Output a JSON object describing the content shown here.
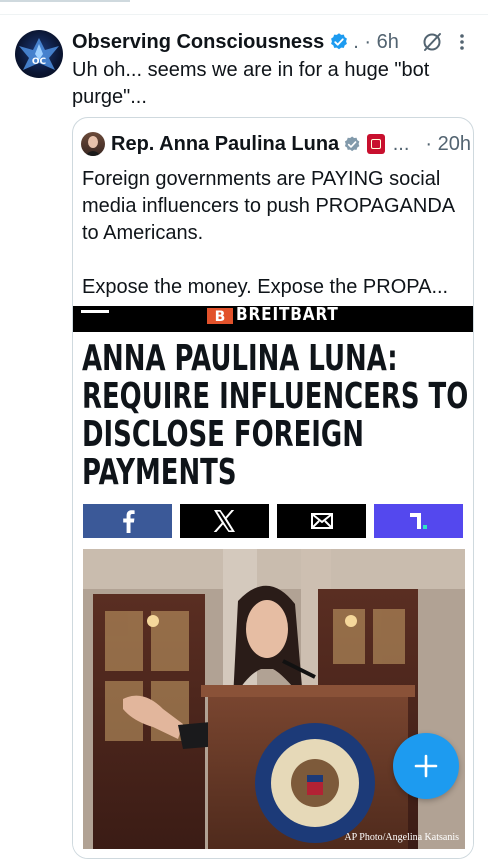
{
  "post": {
    "display_name": "Observing Consciousness",
    "meta": ". · 6h",
    "text": "Uh oh... seems we are in for a huge \"bot purge\"..."
  },
  "quoted": {
    "display_name": "Rep. Anna Paulina Luna",
    "ellipsis": "...",
    "time": "· 20h",
    "text_line1": "Foreign governments are PAYING social media influencers to push PROPAGANDA to Americans.",
    "text_line2": "Expose the money. Expose the PROPA..."
  },
  "article": {
    "site_logo_letter": "B",
    "site_name": "BREITBART",
    "headline_lines": [
      "ANNA PAULINA LUNA:",
      "REQUIRE INFLUENCERS TO",
      "DISCLOSE FOREIGN",
      "PAYMENTS"
    ],
    "photo_credit": "AP Photo/Angelina Katsanis"
  },
  "colors": {
    "accent": "#1d9bf0",
    "facebook": "#3b5998",
    "truth_social": "#5448ee",
    "breitbart_orange": "#e2522b"
  },
  "icons": {
    "verified": "verified-badge-icon",
    "grok": "grok-icon",
    "more": "more-dots-icon",
    "compose": "plus-icon"
  }
}
